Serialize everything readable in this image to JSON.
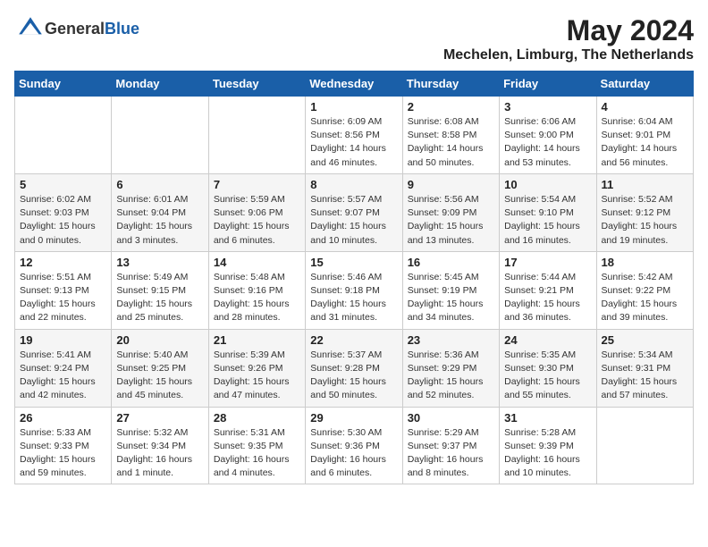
{
  "header": {
    "logo_general": "General",
    "logo_blue": "Blue",
    "month_year": "May 2024",
    "location": "Mechelen, Limburg, The Netherlands"
  },
  "weekdays": [
    "Sunday",
    "Monday",
    "Tuesday",
    "Wednesday",
    "Thursday",
    "Friday",
    "Saturday"
  ],
  "weeks": [
    [
      {
        "day": "",
        "info": ""
      },
      {
        "day": "",
        "info": ""
      },
      {
        "day": "",
        "info": ""
      },
      {
        "day": "1",
        "info": "Sunrise: 6:09 AM\nSunset: 8:56 PM\nDaylight: 14 hours\nand 46 minutes."
      },
      {
        "day": "2",
        "info": "Sunrise: 6:08 AM\nSunset: 8:58 PM\nDaylight: 14 hours\nand 50 minutes."
      },
      {
        "day": "3",
        "info": "Sunrise: 6:06 AM\nSunset: 9:00 PM\nDaylight: 14 hours\nand 53 minutes."
      },
      {
        "day": "4",
        "info": "Sunrise: 6:04 AM\nSunset: 9:01 PM\nDaylight: 14 hours\nand 56 minutes."
      }
    ],
    [
      {
        "day": "5",
        "info": "Sunrise: 6:02 AM\nSunset: 9:03 PM\nDaylight: 15 hours\nand 0 minutes."
      },
      {
        "day": "6",
        "info": "Sunrise: 6:01 AM\nSunset: 9:04 PM\nDaylight: 15 hours\nand 3 minutes."
      },
      {
        "day": "7",
        "info": "Sunrise: 5:59 AM\nSunset: 9:06 PM\nDaylight: 15 hours\nand 6 minutes."
      },
      {
        "day": "8",
        "info": "Sunrise: 5:57 AM\nSunset: 9:07 PM\nDaylight: 15 hours\nand 10 minutes."
      },
      {
        "day": "9",
        "info": "Sunrise: 5:56 AM\nSunset: 9:09 PM\nDaylight: 15 hours\nand 13 minutes."
      },
      {
        "day": "10",
        "info": "Sunrise: 5:54 AM\nSunset: 9:10 PM\nDaylight: 15 hours\nand 16 minutes."
      },
      {
        "day": "11",
        "info": "Sunrise: 5:52 AM\nSunset: 9:12 PM\nDaylight: 15 hours\nand 19 minutes."
      }
    ],
    [
      {
        "day": "12",
        "info": "Sunrise: 5:51 AM\nSunset: 9:13 PM\nDaylight: 15 hours\nand 22 minutes."
      },
      {
        "day": "13",
        "info": "Sunrise: 5:49 AM\nSunset: 9:15 PM\nDaylight: 15 hours\nand 25 minutes."
      },
      {
        "day": "14",
        "info": "Sunrise: 5:48 AM\nSunset: 9:16 PM\nDaylight: 15 hours\nand 28 minutes."
      },
      {
        "day": "15",
        "info": "Sunrise: 5:46 AM\nSunset: 9:18 PM\nDaylight: 15 hours\nand 31 minutes."
      },
      {
        "day": "16",
        "info": "Sunrise: 5:45 AM\nSunset: 9:19 PM\nDaylight: 15 hours\nand 34 minutes."
      },
      {
        "day": "17",
        "info": "Sunrise: 5:44 AM\nSunset: 9:21 PM\nDaylight: 15 hours\nand 36 minutes."
      },
      {
        "day": "18",
        "info": "Sunrise: 5:42 AM\nSunset: 9:22 PM\nDaylight: 15 hours\nand 39 minutes."
      }
    ],
    [
      {
        "day": "19",
        "info": "Sunrise: 5:41 AM\nSunset: 9:24 PM\nDaylight: 15 hours\nand 42 minutes."
      },
      {
        "day": "20",
        "info": "Sunrise: 5:40 AM\nSunset: 9:25 PM\nDaylight: 15 hours\nand 45 minutes."
      },
      {
        "day": "21",
        "info": "Sunrise: 5:39 AM\nSunset: 9:26 PM\nDaylight: 15 hours\nand 47 minutes."
      },
      {
        "day": "22",
        "info": "Sunrise: 5:37 AM\nSunset: 9:28 PM\nDaylight: 15 hours\nand 50 minutes."
      },
      {
        "day": "23",
        "info": "Sunrise: 5:36 AM\nSunset: 9:29 PM\nDaylight: 15 hours\nand 52 minutes."
      },
      {
        "day": "24",
        "info": "Sunrise: 5:35 AM\nSunset: 9:30 PM\nDaylight: 15 hours\nand 55 minutes."
      },
      {
        "day": "25",
        "info": "Sunrise: 5:34 AM\nSunset: 9:31 PM\nDaylight: 15 hours\nand 57 minutes."
      }
    ],
    [
      {
        "day": "26",
        "info": "Sunrise: 5:33 AM\nSunset: 9:33 PM\nDaylight: 15 hours\nand 59 minutes."
      },
      {
        "day": "27",
        "info": "Sunrise: 5:32 AM\nSunset: 9:34 PM\nDaylight: 16 hours\nand 1 minute."
      },
      {
        "day": "28",
        "info": "Sunrise: 5:31 AM\nSunset: 9:35 PM\nDaylight: 16 hours\nand 4 minutes."
      },
      {
        "day": "29",
        "info": "Sunrise: 5:30 AM\nSunset: 9:36 PM\nDaylight: 16 hours\nand 6 minutes."
      },
      {
        "day": "30",
        "info": "Sunrise: 5:29 AM\nSunset: 9:37 PM\nDaylight: 16 hours\nand 8 minutes."
      },
      {
        "day": "31",
        "info": "Sunrise: 5:28 AM\nSunset: 9:39 PM\nDaylight: 16 hours\nand 10 minutes."
      },
      {
        "day": "",
        "info": ""
      }
    ]
  ]
}
